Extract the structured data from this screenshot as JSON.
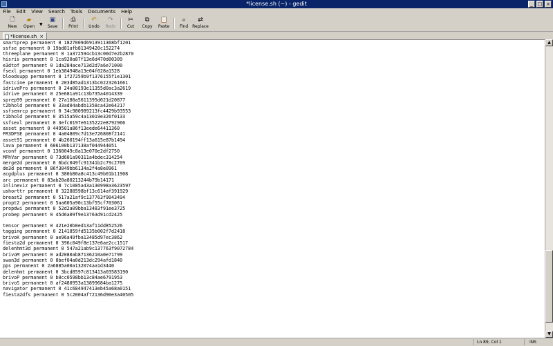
{
  "window": {
    "title": "*license.sh (~) - gedit"
  },
  "menu": [
    "File",
    "Edit",
    "View",
    "Search",
    "Tools",
    "Documents",
    "Help"
  ],
  "toolbar": {
    "new": "New",
    "open": "Open",
    "save": "Save",
    "print": "Print",
    "undo": "Undo",
    "redo": "Redo",
    "cut": "Cut",
    "copy": "Copy",
    "paste": "Paste",
    "find": "Find",
    "replace": "Replace"
  },
  "tab": {
    "label": "*license.sh",
    "close": "×"
  },
  "editor": {
    "lines": [
      "smartprep permanent 0 1827009d6913911368bf1201",
      "ssfse permanent 0 19bd81afb81349420c152274",
      "threeplane permanent 0 1a372594cb13c00d7e2b2870",
      "hisris permanent 0 1ca920a87f13e6d470d00309",
      "e3dtof permanent 0 1da284ace713d2d7a6e71000",
      "fsexl permanent 0 1eb384948a13e04f028a1528",
      "bloodsupp permanent 0 1f27259b9f1376155f1e1301",
      "fastcine permanent 0 203d85ad1313bc0223261661",
      "idrivePro permanent 0 24a08193e11355d0ac3a2619",
      "idrive permanent 0 25e681a91c13b735a4014339",
      "sprep99 permanent 0 27a180a5611395d021d20877",
      "t2bhold permanent 0 33ad04abdb1358ca42e64217",
      "ssfsemrcp permanent 0 34c980989213fc4429b93553",
      "t1bhold permanent 0 3515a59c4a13019e326f0133",
      "ssfsexl permanent 0 3efc0197e6135222e8792966",
      "asset permanent 0 449501a86f13eede64411360",
      "FR3DFSE permanent 0 4a04809c7d13e726808f2141",
      "asset91 permanent 0 4b260194ff13a615e87b1494",
      "lava permanent 0 606100b137138af044944051",
      "vconf permanent 0 1360049c8a13e070e2df2750",
      "MPhVar permanent 0 73d601a90311a4bdec314254",
      "merge2d permanent 0 6bdc049fc91341b2c79c2709",
      "de3d permanent 0 86f3049bb6134a2f4a8e0961",
      "acgdplus permanent 0 380b80a8c413c49b01b11908",
      "arc permanent 0 83ab20a80213244b79b14171",
      "inlineviz permanent 0 7c1085a43a130998a3623597",
      "ushorttr permanent 0 32288598bf13c614af391929",
      "breast2 permanent 0 517a21af9c137763f9043494",
      "propt2 permanent 0 5aa605a90c13bf55cf703061",
      "propdwi permanent 0 52d2a09bba13483f91ee3725",
      "probep permanent 0 45d6a09f9e13763d91cd2425",
      "",
      "tensor permanent 0 421e20b0ed13af11dd852526",
      "tagging permanent 0 2141859fd5135b002f7d2418",
      "brivoK permanent 0 ae96a49fba13485d97ec3862",
      "fiesta2d permanent 0 396c049f8e137e6ae2cc1517",
      "delenhmt3d permanent 0 547a21ab9c137763f9072784",
      "brivoM permanent 0 ad2080ab87136210a0e71799",
      "swan3d permanent 0 8bef04a0d213dc294afd1840",
      "pps permanent 0 2a6885a00a132074aa1d3440",
      "delenhmt permanent 0 3bcd8597c813413a03583190",
      "brivoP permanent 0 b0cc0598bb13c84ae6791953",
      "brivoS permanent 0 af2480953a13899684ba1275",
      "navigator permanent 0 41c684947413eb45a68a0151",
      "fiesta2dfs permanent 0 5c2004af72136d90e3a40505"
    ]
  },
  "status": {
    "position": "Ln 89, Col 1",
    "mode": "INS"
  }
}
